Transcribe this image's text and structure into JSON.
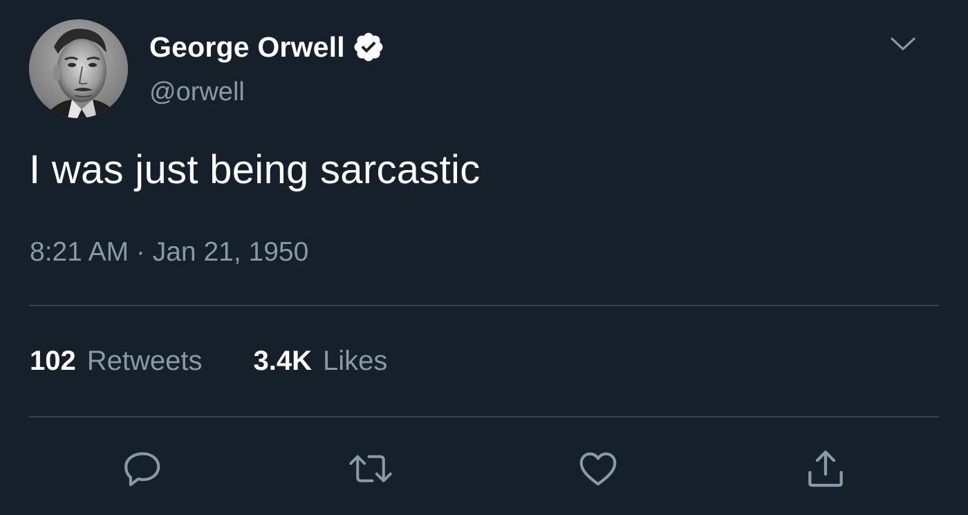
{
  "author": {
    "display_name": "George Orwell",
    "handle": "@orwell",
    "verified_icon": "verified-badge-icon",
    "avatar": "profile-photo"
  },
  "tweet": {
    "text": "I was just being sarcastic",
    "timestamp": "8:21 AM · Jan 21, 1950"
  },
  "stats": {
    "retweets_count": "102",
    "retweets_label": "Retweets",
    "likes_count": "3.4K",
    "likes_label": "Likes"
  },
  "actions": [
    "reply-icon",
    "retweet-icon",
    "like-icon",
    "share-icon"
  ],
  "colors": {
    "background": "#15202b",
    "text_primary": "#ffffff",
    "text_secondary": "#8b98a5",
    "divider": "#38444d",
    "icon": "#8b98a5"
  }
}
